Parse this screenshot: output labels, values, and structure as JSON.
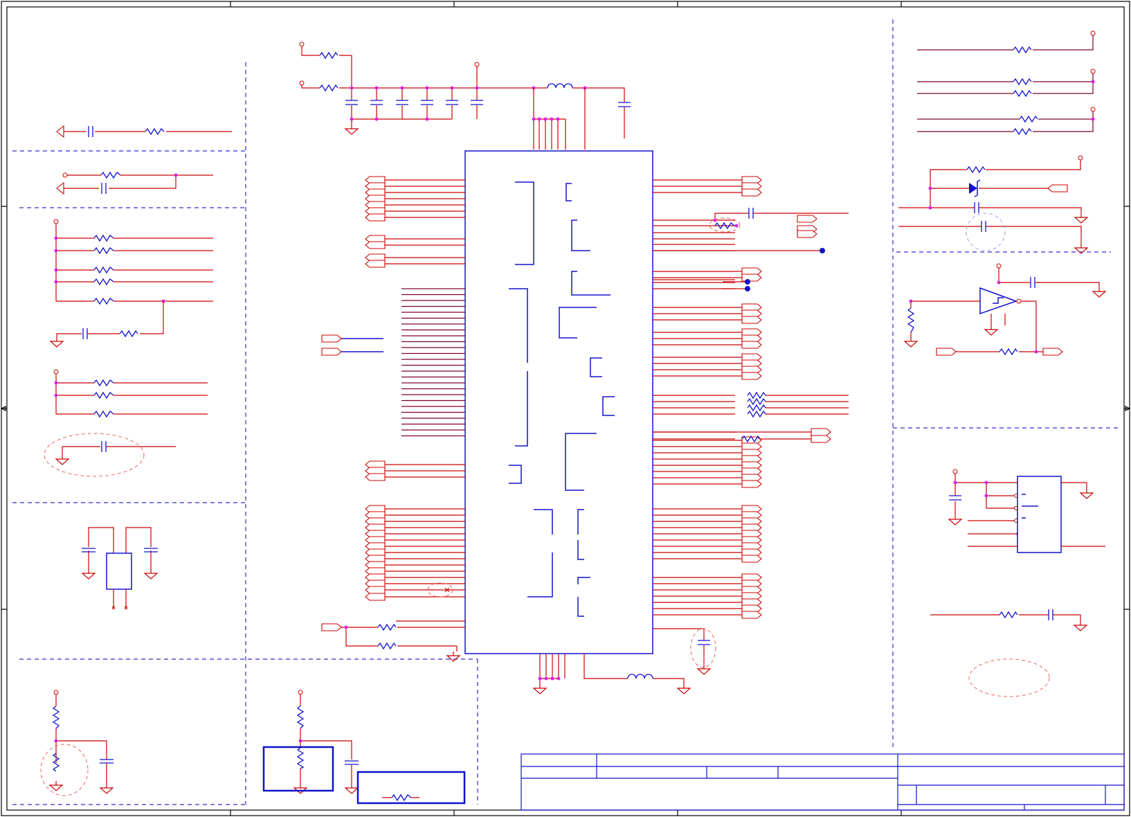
{
  "diagram": {
    "type": "electrical-schematic",
    "colors": {
      "wire": "#cc0000",
      "component": "#1010cc",
      "junction": "#e020e0",
      "frame": "#000000",
      "section_divider": "#2a2ad6",
      "highlight": "#ee6060"
    },
    "sections": [
      "left-column",
      "center-main-ic",
      "right-column",
      "bottom-left",
      "bottom-center",
      "title-block"
    ]
  }
}
